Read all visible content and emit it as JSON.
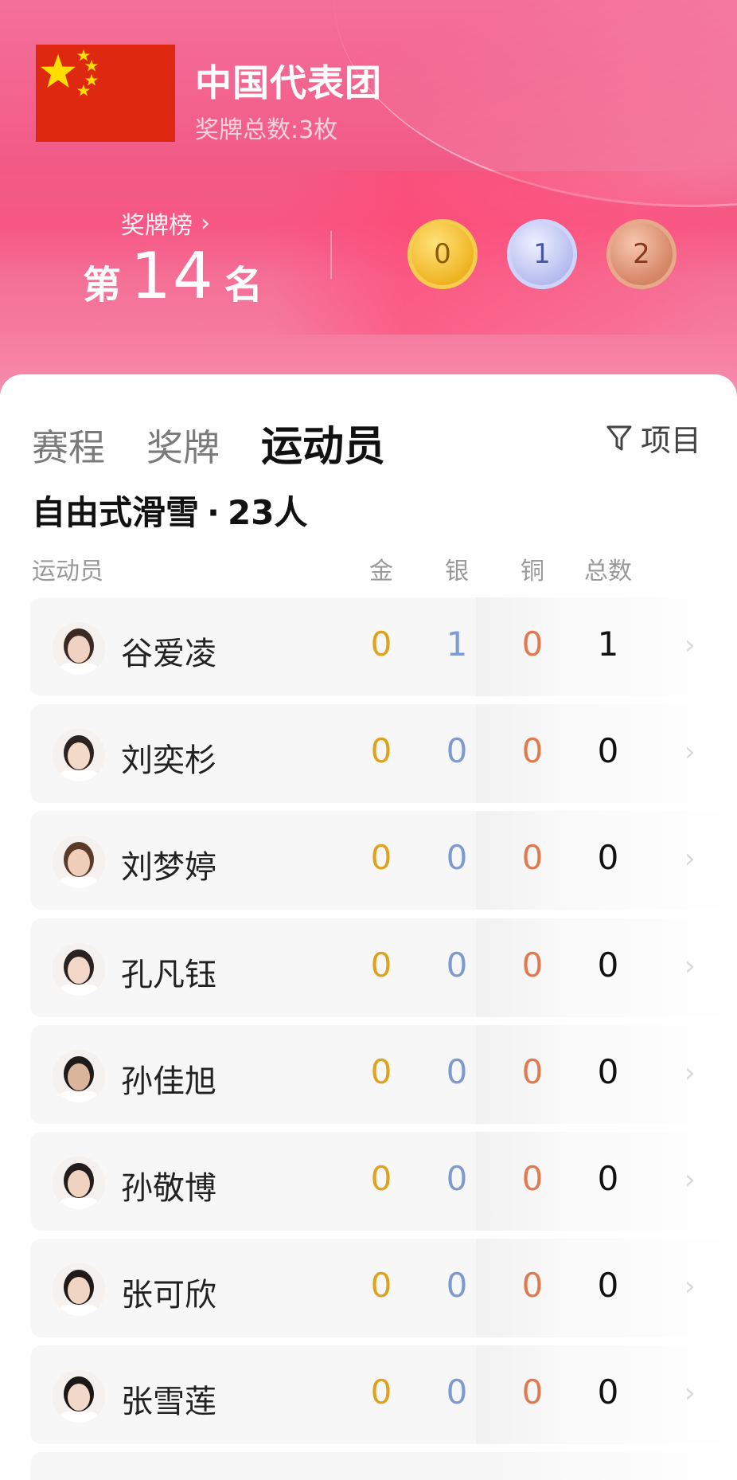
{
  "header": {
    "team_name": "中国代表团",
    "total_medals": "奖牌总数:3枚",
    "rank_link": "奖牌榜",
    "rank_prefix": "第",
    "rank_number": "14",
    "rank_suffix": "名",
    "medals": {
      "gold": "0",
      "silver": "1",
      "bronze": "2"
    }
  },
  "tabs": [
    {
      "label": "赛程"
    },
    {
      "label": "奖牌"
    },
    {
      "label": "运动员"
    }
  ],
  "active_tab": "运动员",
  "filter_label": "项目",
  "section": {
    "sport": "自由式滑雪",
    "sep": "·",
    "count": "23人"
  },
  "columns": {
    "athlete": "运动员",
    "gold": "金",
    "silver": "银",
    "bronze": "铜",
    "total": "总数"
  },
  "athletes": [
    {
      "name": "谷爱凌",
      "gold": "0",
      "silver": "1",
      "bronze": "0",
      "total": "1"
    },
    {
      "name": "刘奕杉",
      "gold": "0",
      "silver": "0",
      "bronze": "0",
      "total": "0"
    },
    {
      "name": "刘梦婷",
      "gold": "0",
      "silver": "0",
      "bronze": "0",
      "total": "0"
    },
    {
      "name": "孔凡钰",
      "gold": "0",
      "silver": "0",
      "bronze": "0",
      "total": "0"
    },
    {
      "name": "孙佳旭",
      "gold": "0",
      "silver": "0",
      "bronze": "0",
      "total": "0"
    },
    {
      "name": "孙敬博",
      "gold": "0",
      "silver": "0",
      "bronze": "0",
      "total": "0"
    },
    {
      "name": "张可欣",
      "gold": "0",
      "silver": "0",
      "bronze": "0",
      "total": "0"
    },
    {
      "name": "张雪莲",
      "gold": "0",
      "silver": "0",
      "bronze": "0",
      "total": "0"
    }
  ],
  "colors": {
    "gold": "#e0a21b",
    "silver": "#7e9ad0",
    "bronze": "#e07a4e",
    "header_pink": "#f25a86"
  }
}
